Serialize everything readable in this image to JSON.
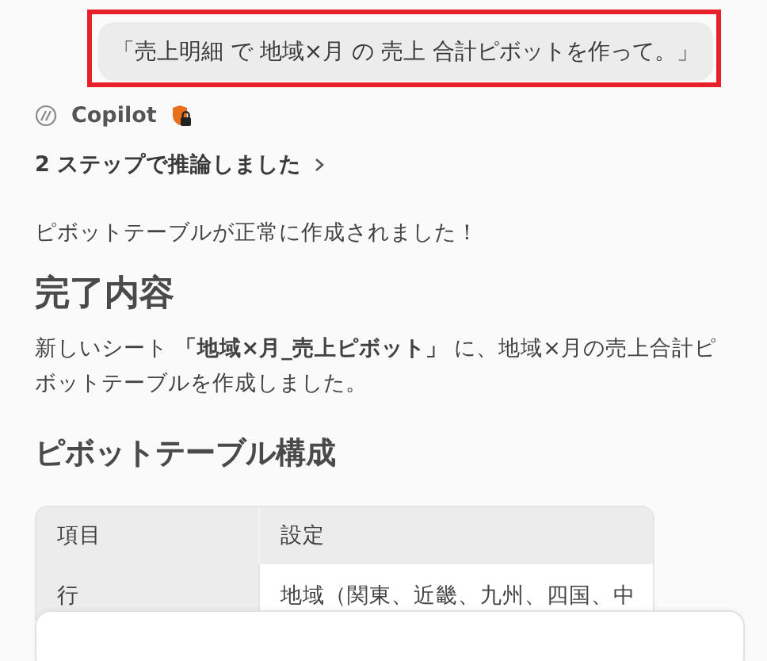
{
  "prompt": {
    "text": "「売上明細 で 地域×月 の 売上 合計ピボットを作って。」",
    "highlighted": true
  },
  "assistant": {
    "name": "Copilot"
  },
  "reasoning": {
    "label": "2 ステップで推論しました",
    "expanded": false
  },
  "message": "ピボットテーブルが正常に作成されました！",
  "sections": [
    {
      "heading": "完了内容",
      "paragraph": "新しいシート **「地域×月_売上ピボット」** に、地域×月の売上合計ピボットテーブルを作成しました。"
    },
    {
      "heading": "ピボットテーブル構成",
      "table": {
        "columns": [
          "項目",
          "設定"
        ],
        "rows": [
          [
            "行",
            "地域（関東、近畿、九州、四国、中"
          ]
        ]
      }
    }
  ]
}
